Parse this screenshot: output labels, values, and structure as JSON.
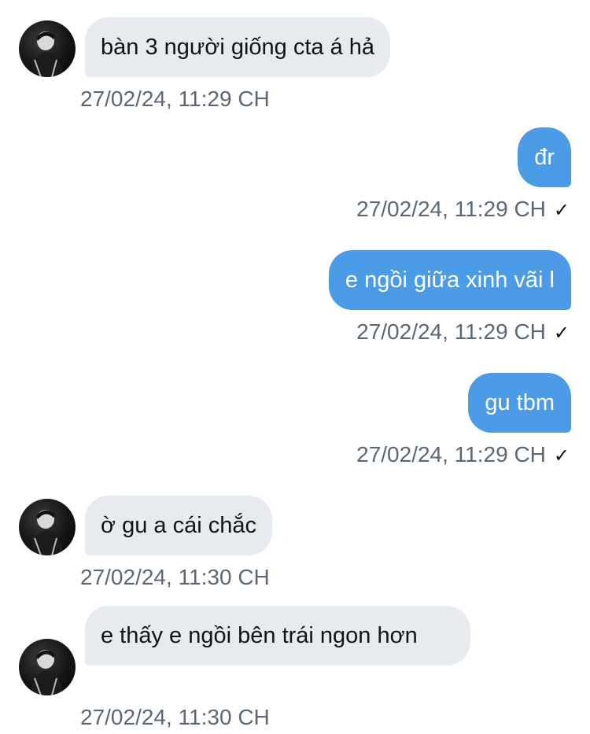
{
  "messages": [
    {
      "text": "bàn 3 người giống cta á hả",
      "time": "27/02/24, 11:29 CH"
    },
    {
      "text": "đr",
      "time": "27/02/24, 11:29 CH"
    },
    {
      "text": "e ngồi giữa xinh vãi l",
      "time": "27/02/24, 11:29 CH"
    },
    {
      "text": "gu tbm",
      "time": "27/02/24, 11:29 CH"
    },
    {
      "text": "ờ gu a cái chắc",
      "time": "27/02/24, 11:30 CH"
    },
    {
      "text": "e thấy e ngồi bên trái ngon hơn",
      "time": "27/02/24, 11:30 CH"
    }
  ],
  "icons": {
    "read_receipt": "checkmark-icon",
    "avatar": "user-avatar"
  },
  "colors": {
    "outgoing_bubble": "#4b9be6",
    "incoming_bubble": "#e7ebf0",
    "timestamp": "#5b6773"
  }
}
